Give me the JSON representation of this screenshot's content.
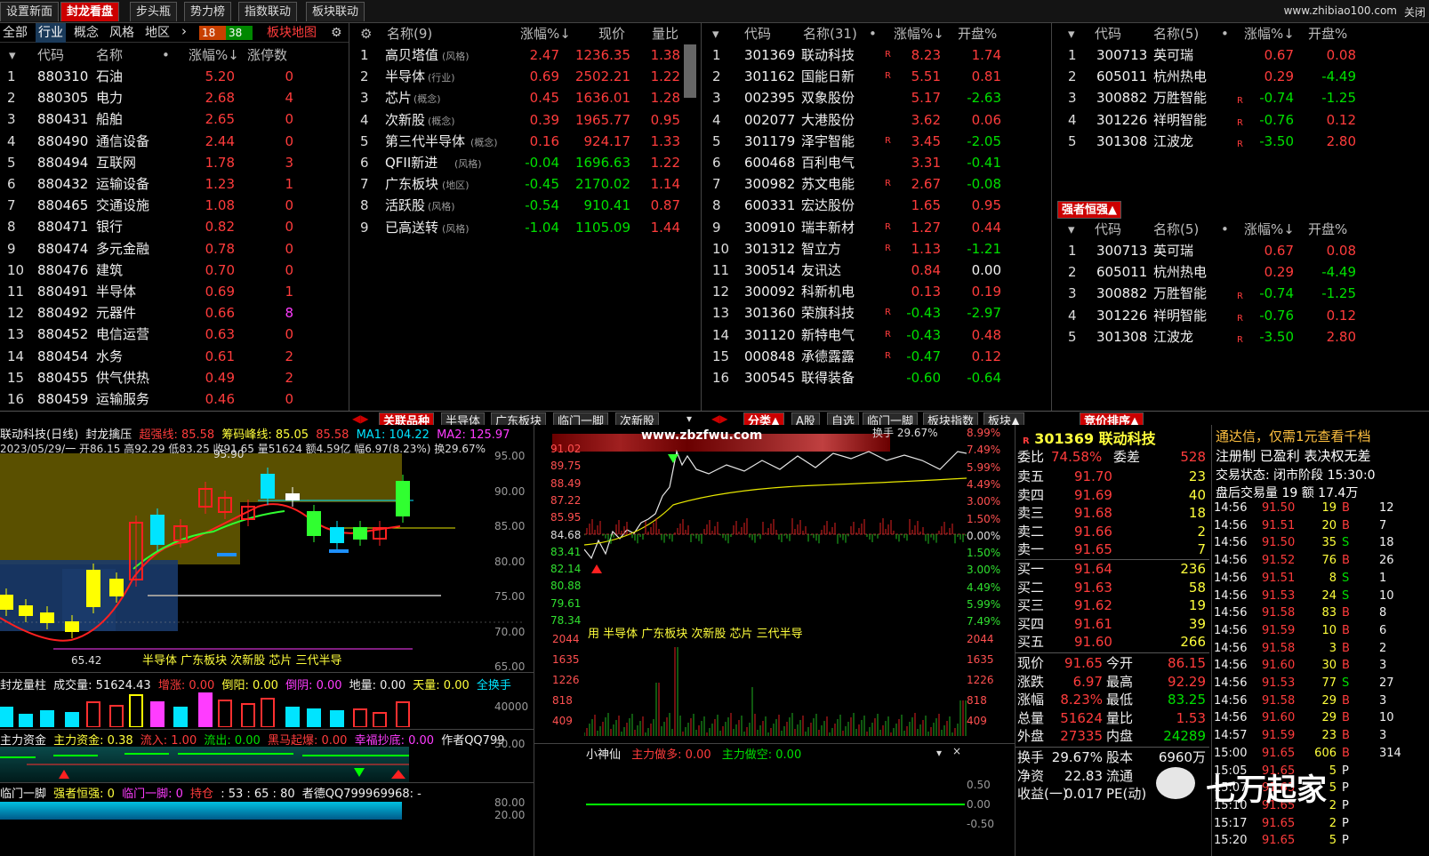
{
  "top_tabs": [
    "设置新面",
    "封龙看盘",
    "步头瓶",
    "势力榜",
    "指数联动",
    "板块联动"
  ],
  "top_tab_active": 1,
  "site": "www.zhibiao100.com",
  "site_right": "关闭",
  "panel1": {
    "subtabs": [
      "全部",
      "行业",
      "概念",
      "风格",
      "地区"
    ],
    "active": 1,
    "badge_left": "18",
    "badge_right": "38",
    "map_label": "板块地图",
    "headers": [
      "代码",
      "名称",
      "•",
      "涨幅%↓",
      "涨停数"
    ],
    "rows": [
      {
        "i": "1",
        "code": "880310",
        "name": "石油",
        "chg": "5.20",
        "zt": "0"
      },
      {
        "i": "2",
        "code": "880305",
        "name": "电力",
        "chg": "2.68",
        "zt": "4"
      },
      {
        "i": "3",
        "code": "880431",
        "name": "船舶",
        "chg": "2.65",
        "zt": "0"
      },
      {
        "i": "4",
        "code": "880490",
        "name": "通信设备",
        "chg": "2.44",
        "zt": "0"
      },
      {
        "i": "5",
        "code": "880494",
        "name": "互联网",
        "chg": "1.78",
        "zt": "3"
      },
      {
        "i": "6",
        "code": "880432",
        "name": "运输设备",
        "chg": "1.23",
        "zt": "1"
      },
      {
        "i": "7",
        "code": "880465",
        "name": "交通设施",
        "chg": "1.08",
        "zt": "0"
      },
      {
        "i": "8",
        "code": "880471",
        "name": "银行",
        "chg": "0.82",
        "zt": "0"
      },
      {
        "i": "9",
        "code": "880474",
        "name": "多元金融",
        "chg": "0.78",
        "zt": "0"
      },
      {
        "i": "10",
        "code": "880476",
        "name": "建筑",
        "chg": "0.70",
        "zt": "0"
      },
      {
        "i": "11",
        "code": "880491",
        "name": "半导体",
        "chg": "0.69",
        "zt": "1"
      },
      {
        "i": "12",
        "code": "880492",
        "name": "元器件",
        "chg": "0.66",
        "zt": "8"
      },
      {
        "i": "13",
        "code": "880452",
        "name": "电信运营",
        "chg": "0.63",
        "zt": "0"
      },
      {
        "i": "14",
        "code": "880454",
        "name": "水务",
        "chg": "0.61",
        "zt": "2"
      },
      {
        "i": "15",
        "code": "880455",
        "name": "供气供热",
        "chg": "0.49",
        "zt": "2"
      },
      {
        "i": "16",
        "code": "880459",
        "name": "运输服务",
        "chg": "0.46",
        "zt": "0"
      }
    ]
  },
  "panel2": {
    "headers": [
      "名称(9)",
      "涨幅%↓",
      "现价",
      "量比"
    ],
    "rows": [
      {
        "i": "1",
        "name": "高贝塔值",
        "tag": "(风格)",
        "chg": "2.47",
        "price": "1236.35",
        "lb": "1.38"
      },
      {
        "i": "2",
        "name": "半导体",
        "tag": "(行业)",
        "chg": "0.69",
        "price": "2502.21",
        "lb": "1.22"
      },
      {
        "i": "3",
        "name": "芯片",
        "tag": "(概念)",
        "chg": "0.45",
        "price": "1636.01",
        "lb": "1.28"
      },
      {
        "i": "4",
        "name": "次新股",
        "tag": "(概念)",
        "chg": "0.39",
        "price": "1965.77",
        "lb": "0.95"
      },
      {
        "i": "5",
        "name": "第三代半导体",
        "tag": "(概念)",
        "chg": "0.16",
        "price": "924.17",
        "lb": "1.33"
      },
      {
        "i": "6",
        "name": "QFII新进",
        "tag": "(风格)",
        "chg": "-0.04",
        "price": "1696.63",
        "lb": "1.22"
      },
      {
        "i": "7",
        "name": "广东板块",
        "tag": "(地区)",
        "chg": "-0.45",
        "price": "2170.02",
        "lb": "1.14"
      },
      {
        "i": "8",
        "name": "活跃股",
        "tag": "(风格)",
        "chg": "-0.54",
        "price": "910.41",
        "lb": "0.87"
      },
      {
        "i": "9",
        "name": "已高送转",
        "tag": "(风格)",
        "chg": "-1.04",
        "price": "1105.09",
        "lb": "1.44"
      }
    ]
  },
  "panel3": {
    "headers": [
      "代码",
      "名称(31)",
      "•",
      "涨幅%↓",
      "开盘%"
    ],
    "rows": [
      {
        "i": "1",
        "code": "301369",
        "name": "联动科技",
        "r": "R",
        "chg": "8.23",
        "open": "1.74"
      },
      {
        "i": "2",
        "code": "301162",
        "name": "国能日新",
        "r": "R",
        "chg": "5.51",
        "open": "0.81"
      },
      {
        "i": "3",
        "code": "002395",
        "name": "双象股份",
        "r": "",
        "chg": "5.17",
        "open": "-2.63"
      },
      {
        "i": "4",
        "code": "002077",
        "name": "大港股份",
        "r": "",
        "chg": "3.62",
        "open": "0.06"
      },
      {
        "i": "5",
        "code": "301179",
        "name": "泽宇智能",
        "r": "R",
        "chg": "3.45",
        "open": "-2.05"
      },
      {
        "i": "6",
        "code": "600468",
        "name": "百利电气",
        "r": "",
        "chg": "3.31",
        "open": "-0.41"
      },
      {
        "i": "7",
        "code": "300982",
        "name": "苏文电能",
        "r": "R",
        "chg": "2.67",
        "open": "-0.08"
      },
      {
        "i": "8",
        "code": "600331",
        "name": "宏达股份",
        "r": "",
        "chg": "1.65",
        "open": "0.95"
      },
      {
        "i": "9",
        "code": "300910",
        "name": "瑞丰新材",
        "r": "R",
        "chg": "1.27",
        "open": "0.44"
      },
      {
        "i": "10",
        "code": "301312",
        "name": "智立方",
        "r": "R",
        "chg": "1.13",
        "open": "-1.21"
      },
      {
        "i": "11",
        "code": "300514",
        "name": "友讯达",
        "r": "",
        "chg": "0.84",
        "open": "0.00"
      },
      {
        "i": "12",
        "code": "300092",
        "name": "科新机电",
        "r": "",
        "chg": "0.13",
        "open": "0.19"
      },
      {
        "i": "13",
        "code": "301360",
        "name": "荣旗科技",
        "r": "R",
        "chg": "-0.43",
        "open": "-2.97"
      },
      {
        "i": "14",
        "code": "301120",
        "name": "新特电气",
        "r": "R",
        "chg": "-0.43",
        "open": "0.48"
      },
      {
        "i": "15",
        "code": "000848",
        "name": "承德露露",
        "r": "R",
        "chg": "-0.47",
        "open": "0.12"
      },
      {
        "i": "16",
        "code": "300545",
        "name": "联得装备",
        "r": "",
        "chg": "-0.60",
        "open": "-0.64"
      }
    ]
  },
  "panel4": {
    "headers": [
      "代码",
      "名称(5)",
      "•",
      "涨幅%↓",
      "开盘%"
    ],
    "rows": [
      {
        "i": "1",
        "code": "300713",
        "name": "英可瑞",
        "r": "",
        "chg": "0.67",
        "open": "0.08"
      },
      {
        "i": "2",
        "code": "605011",
        "name": "杭州热电",
        "r": "",
        "chg": "0.29",
        "open": "-4.49"
      },
      {
        "i": "3",
        "code": "300882",
        "name": "万胜智能",
        "r": "R",
        "chg": "-0.74",
        "open": "-1.25"
      },
      {
        "i": "4",
        "code": "301226",
        "name": "祥明智能",
        "r": "R",
        "chg": "-0.76",
        "open": "0.12"
      },
      {
        "i": "5",
        "code": "301308",
        "name": "江波龙",
        "r": "R",
        "chg": "-3.50",
        "open": "2.80"
      }
    ],
    "section2_tab": "强者恒强▲",
    "rows2": [
      {
        "i": "1",
        "code": "300713",
        "name": "英可瑞",
        "r": "",
        "chg": "0.67",
        "open": "0.08"
      },
      {
        "i": "2",
        "code": "605011",
        "name": "杭州热电",
        "r": "",
        "chg": "0.29",
        "open": "-4.49"
      },
      {
        "i": "3",
        "code": "300882",
        "name": "万胜智能",
        "r": "R",
        "chg": "-0.74",
        "open": "-1.25"
      },
      {
        "i": "4",
        "code": "301226",
        "name": "祥明智能",
        "r": "R",
        "chg": "-0.76",
        "open": "0.12"
      },
      {
        "i": "5",
        "code": "301308",
        "name": "江波龙",
        "r": "R",
        "chg": "-3.50",
        "open": "2.80"
      }
    ],
    "headers2": [
      "代码",
      "名称(5)",
      "•",
      "涨幅%↓",
      "开盘%"
    ]
  },
  "bottom_tabs_mid": [
    "关联品种",
    "半导体",
    "广东板块",
    "临门一脚",
    "次新股"
  ],
  "bottom_tabs_right": [
    "分类▲",
    "A股",
    "自选",
    "临门一脚",
    "板块指数",
    "板块▲"
  ],
  "bottom_tab_far": "竞价排序▲",
  "kline": {
    "title": "联动科技(日线)",
    "ind1": "封龙擒压",
    "ind2": "超强线: 85.58",
    "ind3": "筹码峰线: 85.05",
    "ind4": "85.58",
    "ma1": "MA1: 104.22",
    "ma2": "MA2: 125.97",
    "line2": "2023/05/29/一 开86.15 高92.29 低83.25 收91.65 量51624 额4.59亿 幅6.97(8.23%) 换29.67%",
    "high_label": "95.90",
    "low_label": "65.42",
    "yaxis": [
      "95.00",
      "90.00",
      "85.00",
      "80.00",
      "75.00",
      "70.00",
      "65.00"
    ],
    "tags": "半导体  广东板块 次新股 芯片 三代半导"
  },
  "vol_panel": {
    "title": "封龙量柱",
    "vol": "成交量: 51624.43",
    "a": "增涨: 0.00",
    "b": "倒阳: 0.00",
    "c": "倒阴: 0.00",
    "d": "地量: 0.00",
    "e": "天量: 0.00",
    "f": "全换手",
    "ymax": "40000"
  },
  "money_panel": {
    "title": "主力资金",
    "v1": "主力资金: 0.38",
    "v2": "流入: 1.00",
    "v3": "流出: 0.00",
    "v4": "黑马起爆: 0.00",
    "v5": "幸福抄底: 0.00",
    "v6": "作者QQ799",
    "ytick": "30.00"
  },
  "lmyj_panel": {
    "title": "临门一脚",
    "v1": "强者恒强: 0",
    "v2": "临门一脚: 0",
    "v3": "持仓",
    "v4": ": 53 : 65 : 80",
    "v5": "者德QQ799969968: -",
    "y1": "80.00",
    "y2": "20.00"
  },
  "intraday": {
    "title_left": "联动科技",
    "watermark": "www.zbzfwu.com",
    "turnover": "换手 29.67%",
    "yleft": [
      "91.02",
      "89.75",
      "88.49",
      "87.22",
      "85.95",
      "84.68",
      "83.41",
      "82.14",
      "80.88",
      "79.61",
      "78.34"
    ],
    "yright": [
      "8.99%",
      "7.49%",
      "5.99%",
      "4.49%",
      "3.00%",
      "1.50%",
      "0.00%",
      "1.50%",
      "3.00%",
      "4.49%",
      "5.99%",
      "7.49%"
    ],
    "tags": "用 半导体 广东板块 次新股 芯片 三代半导",
    "vol_y": [
      "2044",
      "1635",
      "1226",
      "818",
      "409"
    ],
    "bottom_title": "小神仙",
    "b1": "主力做多: 0.00",
    "b2": "主力做空: 0.00",
    "b_y": [
      "0.50",
      "0.00",
      "-0.50"
    ]
  },
  "orderbook": {
    "header_code": "301369",
    "header_name": "联动科技",
    "wb_label": "委比",
    "wb": "74.58%",
    "wc_label": "委差",
    "wc": "528",
    "sells": [
      {
        "l": "卖五",
        "p": "91.70",
        "v": "23"
      },
      {
        "l": "卖四",
        "p": "91.69",
        "v": "40"
      },
      {
        "l": "卖三",
        "p": "91.68",
        "v": "18"
      },
      {
        "l": "卖二",
        "p": "91.66",
        "v": "2"
      },
      {
        "l": "卖一",
        "p": "91.65",
        "v": "7"
      }
    ],
    "buys": [
      {
        "l": "买一",
        "p": "91.64",
        "v": "236"
      },
      {
        "l": "买二",
        "p": "91.63",
        "v": "58"
      },
      {
        "l": "买三",
        "p": "91.62",
        "v": "19"
      },
      {
        "l": "买四",
        "p": "91.61",
        "v": "39"
      },
      {
        "l": "买五",
        "p": "91.60",
        "v": "266"
      }
    ],
    "stats": [
      {
        "l1": "现价",
        "v1": "91.65",
        "l2": "今开",
        "v2": "86.15"
      },
      {
        "l1": "涨跌",
        "v1": "6.97",
        "l2": "最高",
        "v2": "92.29"
      },
      {
        "l1": "涨幅",
        "v1": "8.23%",
        "l2": "最低",
        "v2": "83.25"
      },
      {
        "l1": "总量",
        "v1": "51624",
        "l2": "量比",
        "v2": "1.53"
      },
      {
        "l1": "外盘",
        "v1": "27335",
        "l2": "内盘",
        "v2": "24289"
      }
    ],
    "stats2": [
      {
        "l1": "换手",
        "v1": "29.67%",
        "l2": "股本",
        "v2": "6960万"
      },
      {
        "l1": "净资",
        "v1": "22.83",
        "l2": "流通",
        "v2": ""
      },
      {
        "l1": "收益(一)",
        "v1": "0.017",
        "l2": "PE(动)",
        "v2": ""
      }
    ]
  },
  "trades": {
    "notice": "通达信，仅需1元查看千档",
    "l2": "注册制 已盈利 表决权无差",
    "l3": "交易状态: 闭市阶段 15:30:0",
    "l4": "盘后交易量 19 额 17.4万",
    "rows": [
      {
        "t": "14:56",
        "p": "91.50",
        "v": "19",
        "bs": "B",
        "x": "12"
      },
      {
        "t": "14:56",
        "p": "91.51",
        "v": "20",
        "bs": "B",
        "x": "7"
      },
      {
        "t": "14:56",
        "p": "91.50",
        "v": "35",
        "bs": "S",
        "x": "18"
      },
      {
        "t": "14:56",
        "p": "91.52",
        "v": "76",
        "bs": "B",
        "x": "26"
      },
      {
        "t": "14:56",
        "p": "91.51",
        "v": "8",
        "bs": "S",
        "x": "1"
      },
      {
        "t": "14:56",
        "p": "91.53",
        "v": "24",
        "bs": "S",
        "x": "10"
      },
      {
        "t": "14:56",
        "p": "91.58",
        "v": "83",
        "bs": "B",
        "x": "8"
      },
      {
        "t": "14:56",
        "p": "91.59",
        "v": "10",
        "bs": "B",
        "x": "6"
      },
      {
        "t": "14:56",
        "p": "91.58",
        "v": "3",
        "bs": "B",
        "x": "2"
      },
      {
        "t": "14:56",
        "p": "91.60",
        "v": "30",
        "bs": "B",
        "x": "3"
      },
      {
        "t": "14:56",
        "p": "91.53",
        "v": "77",
        "bs": "S",
        "x": "27"
      },
      {
        "t": "14:56",
        "p": "91.58",
        "v": "29",
        "bs": "B",
        "x": "3"
      },
      {
        "t": "14:56",
        "p": "91.60",
        "v": "29",
        "bs": "B",
        "x": "10"
      },
      {
        "t": "14:57",
        "p": "91.59",
        "v": "23",
        "bs": "B",
        "x": "3"
      },
      {
        "t": "15:00",
        "p": "91.65",
        "v": "606",
        "bs": "B",
        "x": "314"
      },
      {
        "t": "15:05",
        "p": "91.65",
        "v": "5",
        "bs": "P",
        "x": ""
      },
      {
        "t": "15:07",
        "p": "91.65",
        "v": "5",
        "bs": "P",
        "x": ""
      },
      {
        "t": "15:10",
        "p": "91.65",
        "v": "2",
        "bs": "P",
        "x": ""
      },
      {
        "t": "15:17",
        "p": "91.65",
        "v": "2",
        "bs": "P",
        "x": ""
      },
      {
        "t": "15:20",
        "p": "91.65",
        "v": "5",
        "bs": "P",
        "x": ""
      }
    ]
  },
  "wechat_brand": "七万起家"
}
